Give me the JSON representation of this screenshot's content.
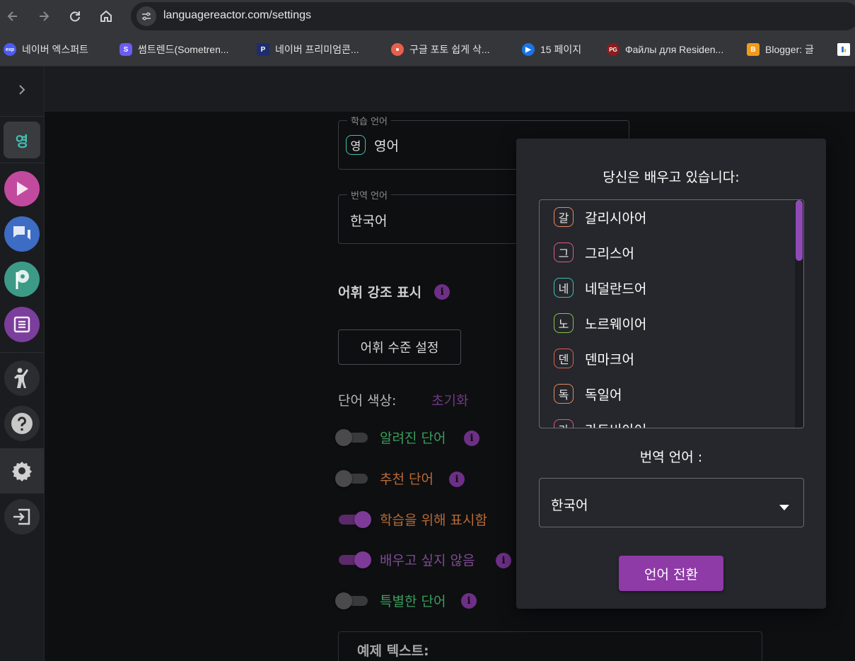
{
  "browser": {
    "url": "languagereactor.com/settings",
    "bookmarks": [
      {
        "label": "네이버 엑스퍼트",
        "icon_text": "exp",
        "color": "#4a5cf0"
      },
      {
        "label": "썸트렌드(Sometren...",
        "icon_text": "S",
        "color": "#6b5cf2"
      },
      {
        "label": "네이버 프리미엄콘...",
        "icon_text": "P",
        "color": "#1f2c6e"
      },
      {
        "label": "구글 포토 쉽게 삭...",
        "icon_text": "",
        "color": "#e8604c"
      },
      {
        "label": "15 페이지",
        "icon_text": "▶",
        "color": "#1a73e8"
      },
      {
        "label": "Файлы для Residen...",
        "icon_text": "PG",
        "color": "#8a1d1d"
      },
      {
        "label": "Blogger: 글",
        "icon_text": "B",
        "color": "#f29a1c"
      },
      {
        "label": "",
        "icon_text": "",
        "color": "#ffffff"
      }
    ]
  },
  "sidebar": {
    "language_chip": "영"
  },
  "settings": {
    "learning_language": {
      "legend": "학습 언어",
      "chip": "영",
      "value": "영어"
    },
    "translation_language": {
      "legend": "번역 언어",
      "value": "한국어"
    },
    "highlight_heading": "어휘 강조 표시",
    "vocab_level_button": "어휘 수준 설정",
    "word_color_label": "단어 색상:",
    "reset_label": "초기화",
    "toggles": [
      {
        "label": "알려진 단어",
        "on": false,
        "color": "#3a9e5c"
      },
      {
        "label": "추천 단어",
        "on": false,
        "color": "#b86a35"
      },
      {
        "label": "학습을 위해 표시함",
        "on": true,
        "color": "#b86a35"
      },
      {
        "label": "배우고 싶지 않음",
        "on": true,
        "color": "#7d4b92"
      },
      {
        "label": "특별한 단어",
        "on": false,
        "color": "#3a9e5c"
      }
    ],
    "example_text_heading": "예제 텍스트:"
  },
  "popup": {
    "title": "당신은 배우고 있습니다:",
    "languages": [
      {
        "chip": "갈",
        "name": "갈리시아어",
        "color": "#e58a5c"
      },
      {
        "chip": "그",
        "name": "그리스어",
        "color": "#e0588a"
      },
      {
        "chip": "네",
        "name": "네덜란드어",
        "color": "#3fc1b0"
      },
      {
        "chip": "노",
        "name": "노르웨이어",
        "color": "#8bc34a"
      },
      {
        "chip": "덴",
        "name": "덴마크어",
        "color": "#e0604c"
      },
      {
        "chip": "독",
        "name": "독일어",
        "color": "#e58a5c"
      },
      {
        "chip": "라",
        "name": "라트비아어",
        "color": "#e0588a"
      }
    ],
    "translation_label": "번역 언어 :",
    "translation_value": "한국어",
    "switch_button": "언어 전환"
  }
}
